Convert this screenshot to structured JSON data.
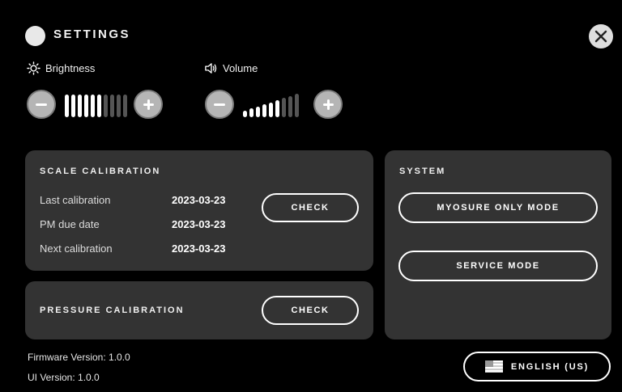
{
  "header": {
    "title": "SETTINGS"
  },
  "brightness": {
    "label": "Brightness",
    "icon": "sun-icon",
    "level": 6,
    "max": 10
  },
  "volume": {
    "label": "Volume",
    "icon": "speaker-icon",
    "level": 6,
    "max": 9
  },
  "scale_calibration": {
    "title": "SCALE CALIBRATION",
    "rows": [
      {
        "label": "Last calibration",
        "value": "2023-03-23"
      },
      {
        "label": "PM due date",
        "value": "2023-03-23"
      },
      {
        "label": "Next calibration",
        "value": "2023-03-23"
      }
    ],
    "button": "CHECK"
  },
  "pressure_calibration": {
    "title": "PRESSURE CALIBRATION",
    "button": "CHECK"
  },
  "system": {
    "title": "SYSTEM",
    "buttons": [
      "MYOSURE ONLY MODE",
      "SERVICE MODE"
    ]
  },
  "footer": {
    "firmware": "Firmware Version: 1.0.0",
    "ui": "UI Version: 1.0.0",
    "language": "ENGLISH (US)",
    "language_icon": "us-flag-icon"
  }
}
